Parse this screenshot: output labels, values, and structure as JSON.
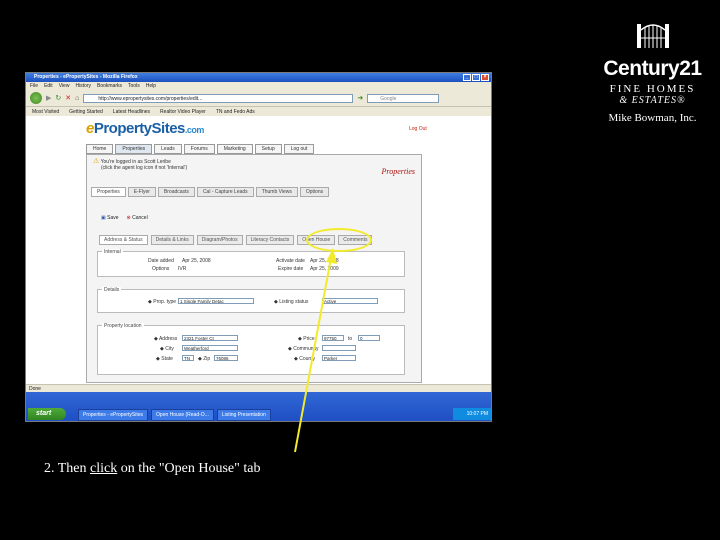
{
  "brand": {
    "century_text": "Century21",
    "fine_homes_text": "FINE HOMES",
    "estates_text": "& ESTATES®",
    "owner_text": "Mike Bowman, Inc."
  },
  "window": {
    "title": "Properties - ePropertySites - Mozilla Firefox",
    "menu": [
      "File",
      "Edit",
      "View",
      "History",
      "Bookmarks",
      "Tools",
      "Help"
    ],
    "url": "http://www.epropertysites.com/properties/edit...",
    "search_placeholder": "Google",
    "bookmarks": [
      "Most Visited",
      "Getting Started",
      "Latest Headlines",
      "Realtor Video Player",
      "TN and Fedo Ads"
    ],
    "site": {
      "logo_e": "e",
      "logo_main": "PropertySites",
      "logo_com": ".com",
      "logout": "Log Out",
      "nav": [
        "Home",
        "Properties",
        "Leads",
        "Forums",
        "Marketing",
        "Setup",
        "Log out"
      ],
      "warning_line1": "You're logged in as Scott Leribe",
      "warning_line2": "(click the agent log icon if not 'Internal')",
      "section_title": "Properties",
      "main_tabs": [
        "Properties",
        "E-Flyer",
        "Broadcasts",
        "Cal - Capture Leads",
        "Thumb Views",
        "Options"
      ],
      "toolbar": {
        "save": "Save",
        "cancel": "Cancel"
      },
      "sub_tabs": [
        "Address & Status",
        "Details & Links",
        "Diagram/Photos",
        "Literacy Contacts",
        "Open House",
        "Comments"
      ],
      "internal": {
        "legend": "Internal",
        "date_added_label": "Date added",
        "date_added_value": "Apr 25, 2008",
        "options_label": "Options",
        "options_value": "IVR",
        "activate_label": "Activate date",
        "activate_value": "Apr 25, 2008",
        "expire_label": "Expire date",
        "expire_value": "Apr 25, 2009"
      },
      "details": {
        "legend": "Details",
        "prop_type_label": "Prop. type",
        "prop_type_value": "1 Single Family Detac",
        "listing_status_label": "Listing status",
        "listing_status_value": "Active"
      },
      "location": {
        "legend": "Property location",
        "address_label": "Address",
        "address_value": "2321 Foster Ct",
        "city_label": "City",
        "city_value": "Weatherford",
        "state_label": "State",
        "state_value": "TN",
        "zip_label": "Zip",
        "zip_value": "76086",
        "price_label": "Price",
        "price_value": "97750",
        "price_to_label": "to",
        "price_to_value": "0",
        "community_label": "Community",
        "community_value": "",
        "county_label": "County",
        "county_value": "Parker"
      }
    },
    "status_text": "Done",
    "taskbar": {
      "start": "start",
      "tasks": [
        "Properties - ePropertySites",
        "Open House (Read-O...",
        "Listing Presentation"
      ],
      "clock": "10:07 PM"
    }
  },
  "caption": {
    "prefix": "2. Then ",
    "link": "click",
    "suffix": " on the \"Open House\" tab"
  },
  "colors": {
    "highlight": "#f2ea2a",
    "background": "#000000"
  }
}
